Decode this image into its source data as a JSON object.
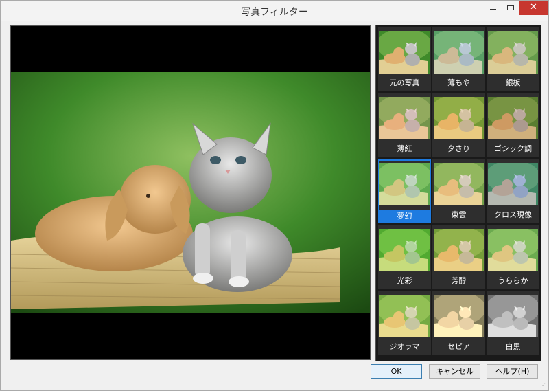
{
  "window": {
    "title": "写真フィルター",
    "close_glyph": "✕"
  },
  "filters": [
    {
      "label": "元の写真",
      "tint": "none"
    },
    {
      "label": "薄もや",
      "tint": "#9ad4ff"
    },
    {
      "label": "銀板",
      "tint": "#c8c8a0"
    },
    {
      "label": "薄紅",
      "tint": "#ffb0a0"
    },
    {
      "label": "夕さり",
      "tint": "#ffc050"
    },
    {
      "label": "ゴシック調",
      "tint": "#a06040"
    },
    {
      "label": "夢幻",
      "tint": "#b0ffb0"
    },
    {
      "label": "東雲",
      "tint": "#ffe0a0"
    },
    {
      "label": "クロス現像",
      "tint": "#4080ff"
    },
    {
      "label": "光彩",
      "tint": "#80ff40"
    },
    {
      "label": "芳醇",
      "tint": "#ffd060"
    },
    {
      "label": "うららか",
      "tint": "#e0ffb0"
    },
    {
      "label": "ジオラマ",
      "tint": "#ffff80"
    },
    {
      "label": "セピア",
      "tint": "sepia"
    },
    {
      "label": "白黒",
      "tint": "gray"
    }
  ],
  "selected_filter": "夢幻",
  "buttons": {
    "ok": "OK",
    "cancel": "キャンセル",
    "help": "ヘルプ(H)"
  },
  "colors": {
    "accent": "#1e7be0",
    "close": "#c7372f"
  }
}
